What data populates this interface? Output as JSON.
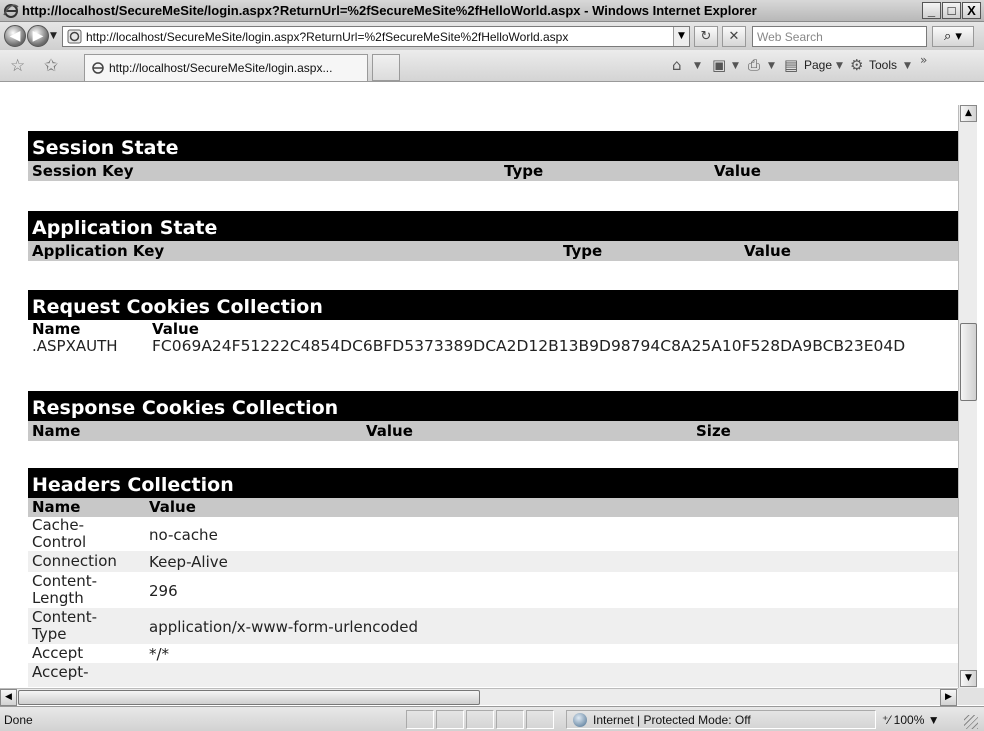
{
  "window": {
    "title": "http://localhost/SecureMeSite/login.aspx?ReturnUrl=%2fSecureMeSite%2fHelloWorld.aspx - Windows Internet Explorer",
    "minimize": "_",
    "maximize": "□",
    "close": "X"
  },
  "addressbar": {
    "url": "http://localhost/SecureMeSite/login.aspx?ReturnUrl=%2fSecureMeSite%2fHelloWorld.aspx",
    "search_placeholder": "Web Search"
  },
  "tabs": [
    {
      "label": "http://localhost/SecureMeSite/login.aspx..."
    }
  ],
  "commandbar": {
    "page": "Page",
    "tools": "Tools"
  },
  "trace": {
    "session_state": {
      "title": "Session State",
      "columns": [
        "Session Key",
        "Type",
        "Value"
      ]
    },
    "application_state": {
      "title": "Application State",
      "columns": [
        "Application Key",
        "Type",
        "Value"
      ]
    },
    "request_cookies": {
      "title": "Request Cookies Collection",
      "columns": [
        "Name",
        "Value"
      ],
      "rows": [
        {
          "name": ".ASPXAUTH",
          "value": "FC069A24F51222C4854DC6BFD5373389DCA2D12B13B9D98794C8A25A10F528DA9BCB23E04D"
        }
      ]
    },
    "response_cookies": {
      "title": "Response Cookies Collection",
      "columns": [
        "Name",
        "Value",
        "Size"
      ]
    },
    "headers": {
      "title": "Headers Collection",
      "columns": [
        "Name",
        "Value"
      ],
      "rows": [
        {
          "name_1": "Cache-",
          "name_2": "Control",
          "value": "no-cache"
        },
        {
          "name_1": "Connection",
          "name_2": "",
          "value": "Keep-Alive"
        },
        {
          "name_1": "Content-",
          "name_2": "Length",
          "value": "296"
        },
        {
          "name_1": "Content-",
          "name_2": "Type",
          "value": "application/x-www-form-urlencoded"
        },
        {
          "name_1": "Accept",
          "name_2": "",
          "value": "*/*"
        },
        {
          "name_1": "Accept-",
          "name_2": "",
          "value": ""
        }
      ]
    }
  },
  "statusbar": {
    "status": "Done",
    "zone": "Internet | Protected Mode: Off",
    "zoom": "100%"
  }
}
